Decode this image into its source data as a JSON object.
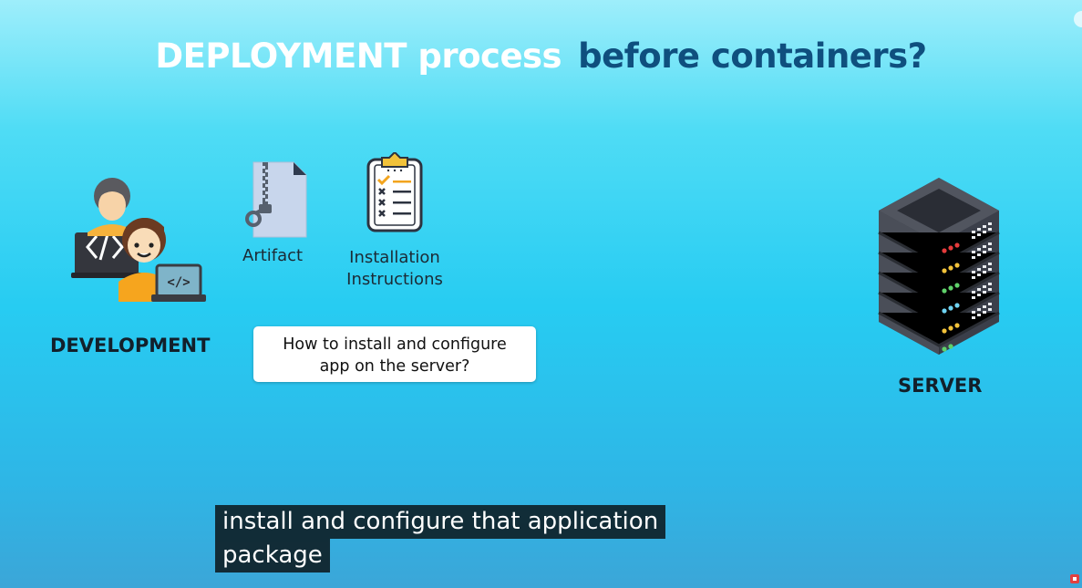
{
  "slide": {
    "title_part1": "DEPLOYMENT",
    "title_part2": "process",
    "title_part3": "before containers?",
    "development_label": "DEVELOPMENT",
    "artifact_label": "Artifact",
    "installation_line1": "Installation",
    "installation_line2": "Instructions",
    "note_line1": "How to install and configure",
    "note_line2": "app on the server?",
    "server_label": "SERVER"
  },
  "caption": {
    "line1": "install and configure that application",
    "line2": "package"
  },
  "icons": {
    "developers": "developers-icon",
    "artifact": "zip-file-icon",
    "instructions": "clipboard-checklist-icon",
    "server": "server-rack-icon"
  },
  "colors": {
    "title_white": "#ffffff",
    "title_dark": "#0f4f7e",
    "background": "#27ccf2"
  }
}
